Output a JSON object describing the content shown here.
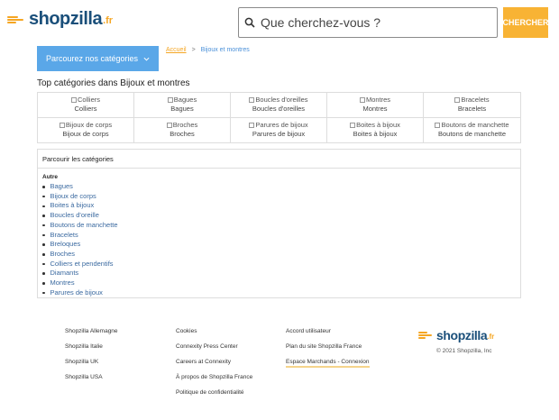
{
  "header": {
    "logo_word": "shopzilla",
    "logo_tld": ".fr",
    "search_placeholder": "Que cherchez-vous ?",
    "search_button": "CHERCHER"
  },
  "nav": {
    "browse_label": "Parcourez nos catégories",
    "breadcrumb": {
      "home": "Accueil",
      "sep": ">",
      "current": "Bijoux et montres"
    }
  },
  "top_categories": {
    "title": "Top catégories dans Bijoux et montres",
    "items": [
      {
        "alt": "Colliers",
        "label": "Colliers"
      },
      {
        "alt": "Bagues",
        "label": "Bagues"
      },
      {
        "alt": "Boucles d'oreilles",
        "label": "Boucles d'oreilles"
      },
      {
        "alt": "Montres",
        "label": "Montres"
      },
      {
        "alt": "Bracelets",
        "label": "Bracelets"
      },
      {
        "alt": "Bijoux de corps",
        "label": "Bijoux de corps"
      },
      {
        "alt": "Broches",
        "label": "Broches"
      },
      {
        "alt": "Parures de bijoux",
        "label": "Parures de bijoux"
      },
      {
        "alt": "Boites à bijoux",
        "label": "Boites à bijoux"
      },
      {
        "alt": "Boutons de manchette",
        "label": "Boutons de manchette"
      }
    ]
  },
  "browse_categories": {
    "title": "Parcourir les catégories",
    "group": "Autre",
    "items": [
      "Bagues",
      "Bijoux de corps",
      "Boites à bijoux",
      "Boucles d'oreille",
      "Boutons de manchette",
      "Bracelets",
      "Breloques",
      "Broches",
      "Colliers et pendentifs",
      "Diamants",
      "Montres",
      "Parures de bijoux"
    ]
  },
  "footer": {
    "col1": [
      "Shopzilla Allemagne",
      "Shopzilla Italie",
      "Shopzilla UK",
      "Shopzilla USA"
    ],
    "col2": [
      "Cookies",
      "Connexity Press Center",
      "Careers at Connexity",
      "À propos de Shopzilla France",
      "Politique de confidentialité"
    ],
    "col3": [
      "Accord utilisateur",
      "Plan du site Shopzilla France",
      "Espace Marchands - Connexion"
    ],
    "logo_word": "shopzilla",
    "logo_tld": ".fr",
    "copyright": "© 2021 Shopzilla, Inc"
  },
  "colors": {
    "brand_blue": "#1a4f7a",
    "accent_orange": "#f5a623",
    "browse_blue": "#5aa7e8",
    "search_button": "#f8b334"
  }
}
